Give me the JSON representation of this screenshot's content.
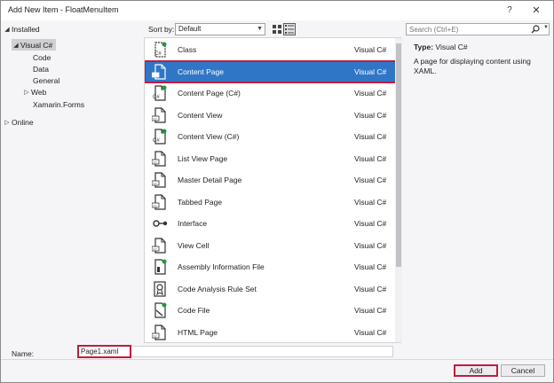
{
  "window": {
    "title": "Add New Item - FloatMenuItem",
    "help": "?",
    "close": "✕"
  },
  "tree": {
    "installed": "Installed",
    "visual_cs": "Visual C#",
    "code": "Code",
    "data": "Data",
    "general": "General",
    "web": "Web",
    "xamarin_forms": "Xamarin.Forms",
    "online": "Online"
  },
  "toolbar": {
    "sort_label": "Sort by:",
    "sort_value": "Default"
  },
  "search": {
    "placeholder": "Search (Ctrl+E)"
  },
  "templates": [
    {
      "name": "Class",
      "lang": "Visual C#",
      "icon": "class-icon"
    },
    {
      "name": "Content Page",
      "lang": "Visual C#",
      "icon": "xaml-page-icon"
    },
    {
      "name": "Content Page (C#)",
      "lang": "Visual C#",
      "icon": "cs-page-icon"
    },
    {
      "name": "Content View",
      "lang": "Visual C#",
      "icon": "xaml-page-icon"
    },
    {
      "name": "Content View (C#)",
      "lang": "Visual C#",
      "icon": "cs-page-icon"
    },
    {
      "name": "List View Page",
      "lang": "Visual C#",
      "icon": "xaml-page-icon"
    },
    {
      "name": "Master Detail Page",
      "lang": "Visual C#",
      "icon": "xaml-page-icon"
    },
    {
      "name": "Tabbed Page",
      "lang": "Visual C#",
      "icon": "xaml-page-icon"
    },
    {
      "name": "Interface",
      "lang": "Visual C#",
      "icon": "interface-icon"
    },
    {
      "name": "View Cell",
      "lang": "Visual C#",
      "icon": "xaml-page-icon"
    },
    {
      "name": "Assembly Information File",
      "lang": "Visual C#",
      "icon": "assembly-info-icon"
    },
    {
      "name": "Code Analysis Rule Set",
      "lang": "Visual C#",
      "icon": "ruleset-icon"
    },
    {
      "name": "Code File",
      "lang": "Visual C#",
      "icon": "code-file-icon"
    },
    {
      "name": "HTML Page",
      "lang": "Visual C#",
      "icon": "html-page-icon"
    }
  ],
  "selected_index": 1,
  "details": {
    "type_key": "Type:",
    "type_value": "Visual C#",
    "description": "A page for displaying content using XAML."
  },
  "footer": {
    "name_label": "Name:",
    "name_value": "Page1.xaml",
    "add": "Add",
    "cancel": "Cancel"
  },
  "colors": {
    "selection": "#3076c7",
    "highlight": "#c21c3c",
    "accent_green": "#1d9a3a"
  }
}
